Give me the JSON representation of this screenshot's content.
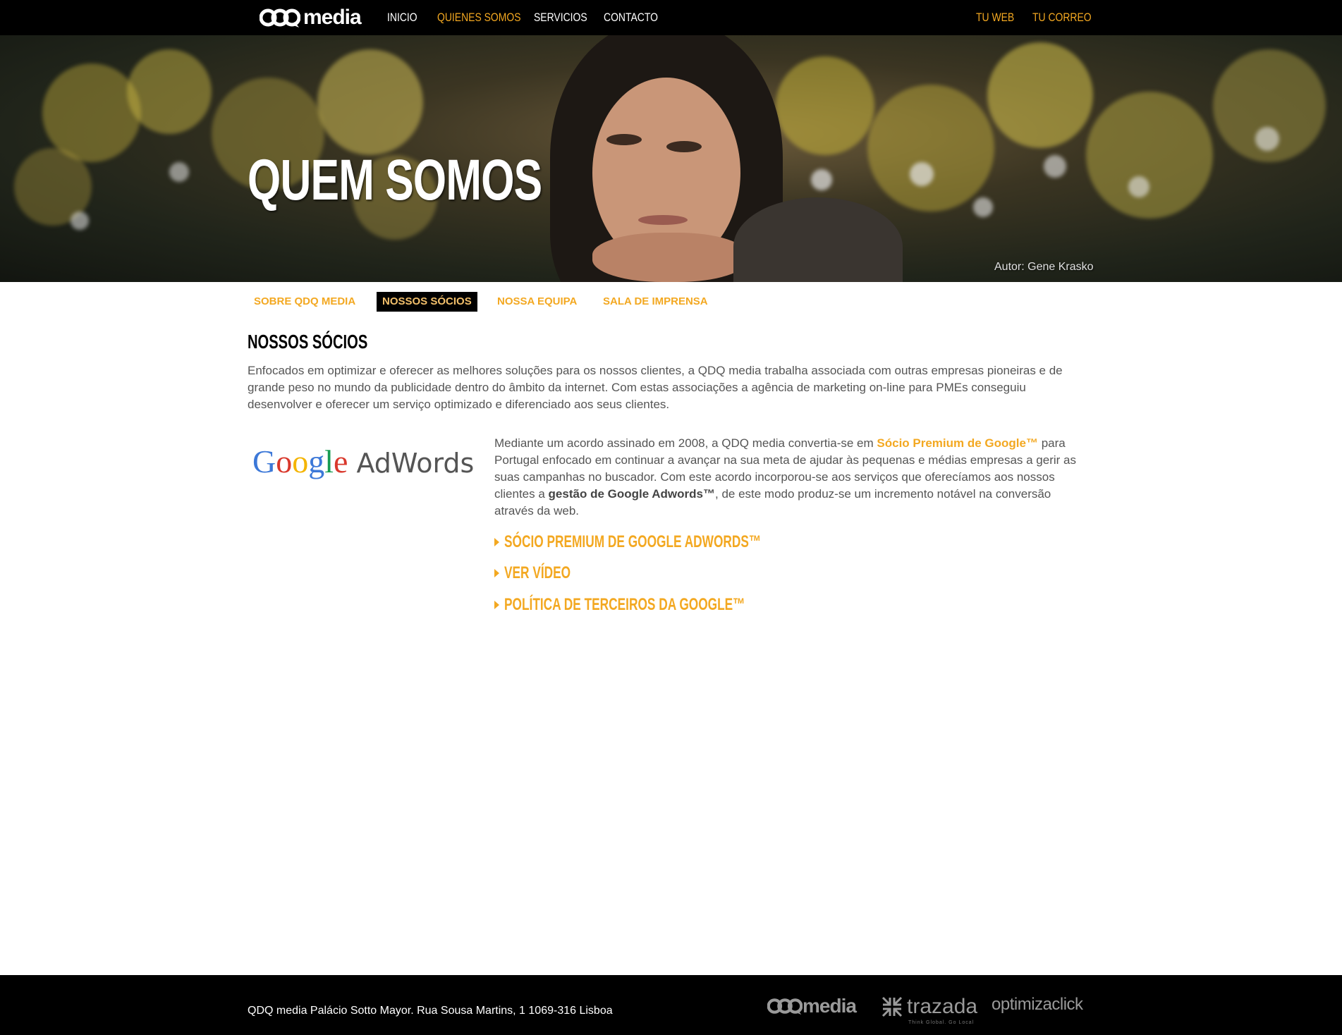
{
  "brand": {
    "logo_text": "media"
  },
  "nav": {
    "items": [
      {
        "label": "INICIO",
        "active": false
      },
      {
        "label": "QUIENES SOMOS",
        "active": true
      },
      {
        "label": "SERVICIOS",
        "active": false
      },
      {
        "label": "CONTACTO",
        "active": false
      }
    ],
    "right_items": [
      {
        "label": "TU WEB"
      },
      {
        "label": "TU CORREO"
      }
    ]
  },
  "hero": {
    "title": "QUEM SOMOS",
    "credit": "Autor: Gene Krasko"
  },
  "subnav": {
    "tabs": [
      {
        "label": "SOBRE QDQ MEDIA",
        "active": false
      },
      {
        "label": "NOSSOS SÓCIOS",
        "active": true
      },
      {
        "label": "NOSSA EQUIPA",
        "active": false
      },
      {
        "label": "SALA DE IMPRENSA",
        "active": false
      }
    ]
  },
  "section": {
    "title": "NOSSOS SÓCIOS",
    "intro": "Enfocados em optimizar e oferecer as melhores soluções para os nossos clientes, a QDQ media trabalha associada com outras empresas pioneiras e de grande peso no mundo da publicidade dentro do âmbito da internet. Com estas associações a agência de marketing on-line para PMEs conseguiu desenvolver e oferecer um serviço optimizado e diferenciado aos seus clientes."
  },
  "partner": {
    "logo_google": "Google",
    "logo_product": "AdWords",
    "text_part1": "Mediante um acordo assinado em 2008, a QDQ media convertia-se em ",
    "text_link": "Sócio Premium de Google™",
    "text_part2": " para Portugal enfocado em continuar a avançar na sua meta de ajudar às pequenas e médias empresas a gerir as suas campanhas no buscador. Com este acordo incorporou-se aos serviços que oferecíamos aos nossos clientes a ",
    "text_bold": "gestão de Google Adwords™",
    "text_part3": ", de este modo produz-se um incremento notável na conversão através da web.",
    "links": [
      {
        "label": "SÓCIO PREMIUM DE GOOGLE ADWORDS™"
      },
      {
        "label": "VER VÍDEO"
      },
      {
        "label": "POLÍTICA DE TERCEIROS DA GOOGLE™"
      }
    ]
  },
  "footer": {
    "address": "QDQ media Palácio Sotto Mayor. Rua Sousa Martins, 1 1069-316 Lisboa",
    "logos": [
      {
        "name": "media"
      },
      {
        "name": "trazada",
        "tagline": "Think Global. Go Local"
      },
      {
        "name": "optimizaclick"
      }
    ]
  },
  "colors": {
    "accent": "#f3a821",
    "nav_bg": "#000000",
    "text": "#555555",
    "footer_logo": "#9a9a9a"
  },
  "icons": {
    "logo": "qdq-bubble-icon",
    "link_bullet": "caret-right-icon"
  }
}
